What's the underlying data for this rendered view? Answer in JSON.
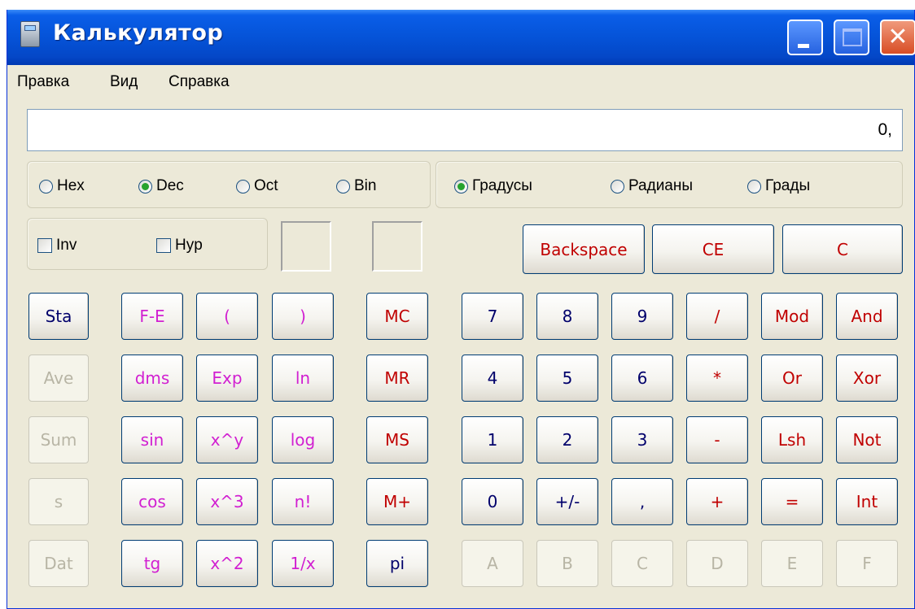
{
  "window": {
    "title": "Калькулятор"
  },
  "menu": [
    "Правка",
    "Вид",
    "Справка"
  ],
  "display": {
    "value": "0,"
  },
  "radix": {
    "options": [
      {
        "label": "Hex",
        "selected": false
      },
      {
        "label": "Dec",
        "selected": true
      },
      {
        "label": "Oct",
        "selected": false
      },
      {
        "label": "Bin",
        "selected": false
      }
    ]
  },
  "angle": {
    "options": [
      {
        "label": "Градусы",
        "selected": true
      },
      {
        "label": "Радианы",
        "selected": false
      },
      {
        "label": "Грады",
        "selected": false
      }
    ]
  },
  "checks": [
    {
      "label": "Inv",
      "checked": false
    },
    {
      "label": "Hyp",
      "checked": false
    }
  ],
  "clear_buttons": [
    "Backspace",
    "CE",
    "C"
  ],
  "stat_buttons": [
    "Sta",
    "Ave",
    "Sum",
    "s",
    "Dat"
  ],
  "func_buttons": {
    "col1": [
      "F-E",
      "dms",
      "sin",
      "cos",
      "tg"
    ],
    "col2": [
      "(",
      "Exp",
      "x^y",
      "x^3",
      "x^2"
    ],
    "col3": [
      ")",
      "ln",
      "log",
      "n!",
      "1/x"
    ]
  },
  "memory_buttons": [
    "MC",
    "MR",
    "MS",
    "M+",
    "pi"
  ],
  "keypad": {
    "rows": [
      [
        "7",
        "8",
        "9",
        "/",
        "Mod",
        "And"
      ],
      [
        "4",
        "5",
        "6",
        "*",
        "Or",
        "Xor"
      ],
      [
        "1",
        "2",
        "3",
        "-",
        "Lsh",
        "Not"
      ],
      [
        "0",
        "+/-",
        ",",
        "+",
        "=",
        "Int"
      ],
      [
        "A",
        "B",
        "C",
        "D",
        "E",
        "F"
      ]
    ]
  },
  "colors": {
    "title_bar": "#0553d8",
    "operator_red": "#c00000",
    "digit_blue": "#00006b",
    "function_pink": "#d11fd1",
    "disabled_gray": "#b8b5a5"
  }
}
